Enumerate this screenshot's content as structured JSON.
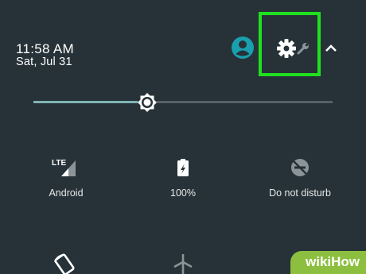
{
  "status": {
    "time": "11:58 AM",
    "date": "Sat, Jul 31"
  },
  "header_icons": [
    {
      "name": "user-avatar-icon",
      "color": "#1a9faf"
    },
    {
      "name": "settings-gear-icon",
      "color": "#ffffff"
    },
    {
      "name": "wrench-icon",
      "color": "#8a9499"
    },
    {
      "name": "chevron-up-icon",
      "color": "#ffffff"
    }
  ],
  "highlight_color": "#1fe01f",
  "brightness": {
    "level_fraction": 0.38
  },
  "tiles": [
    {
      "label": "Android",
      "icon": "lte-signal-icon"
    },
    {
      "label": "100%",
      "icon": "battery-saver-icon"
    },
    {
      "label": "Do not disturb",
      "icon": "do-not-disturb-icon"
    }
  ],
  "bottom_tiles": [
    {
      "icon": "auto-rotate-icon"
    },
    {
      "icon": "airplane-mode-icon"
    },
    {
      "icon": "location-icon"
    }
  ],
  "watermark": {
    "text": "wikiHow",
    "color": "#8cbf3f"
  }
}
